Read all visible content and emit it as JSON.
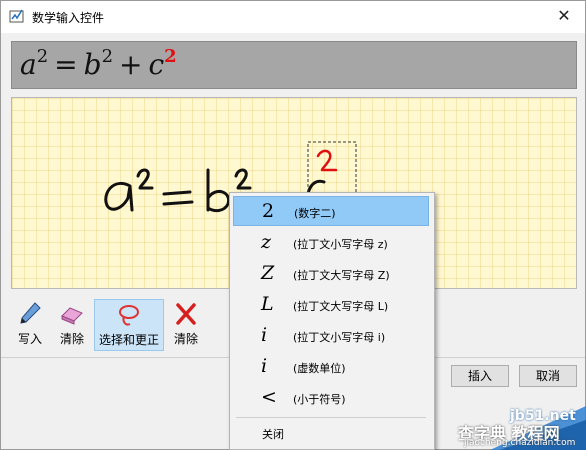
{
  "window": {
    "title": "数学输入控件",
    "close_glyph": "✕"
  },
  "preview": {
    "formula": {
      "a": "a",
      "b": "b",
      "c": "c",
      "exp": "2",
      "eq": "=",
      "plus": "+"
    }
  },
  "toolbar": [
    {
      "label": "写入",
      "icon": "pen-icon"
    },
    {
      "label": "清除",
      "icon": "eraser-icon"
    },
    {
      "label": "选择和更正",
      "icon": "lasso-icon",
      "selected": true
    },
    {
      "label": "清除",
      "icon": "x-icon"
    }
  ],
  "buttons": {
    "insert": "插入",
    "cancel": "取消"
  },
  "context_menu": {
    "items": [
      {
        "symbol": "2",
        "desc": "(数字二)",
        "highlighted": true
      },
      {
        "symbol": "z",
        "desc": "(拉丁文小写字母 z)"
      },
      {
        "symbol": "Z",
        "desc": "(拉丁文大写字母 Z)"
      },
      {
        "symbol": "L",
        "desc": "(拉丁文大写字母 L)"
      },
      {
        "symbol": "i",
        "desc": "(拉丁文小写字母 i)"
      },
      {
        "symbol": "i",
        "desc": "(虚数单位)"
      },
      {
        "symbol": "<",
        "desc": "(小于符号)"
      }
    ],
    "close_label": "关闭"
  },
  "watermark": {
    "line1": "jb51.net",
    "line2": "查字典 教程网",
    "line3": "jiaocheng.chazidian.com"
  },
  "colors": {
    "accent_red": "#e01010",
    "menu_highlight": "#91c9f7",
    "preview_bg": "#a6a6a6",
    "canvas_bg": "#fff8d0"
  }
}
